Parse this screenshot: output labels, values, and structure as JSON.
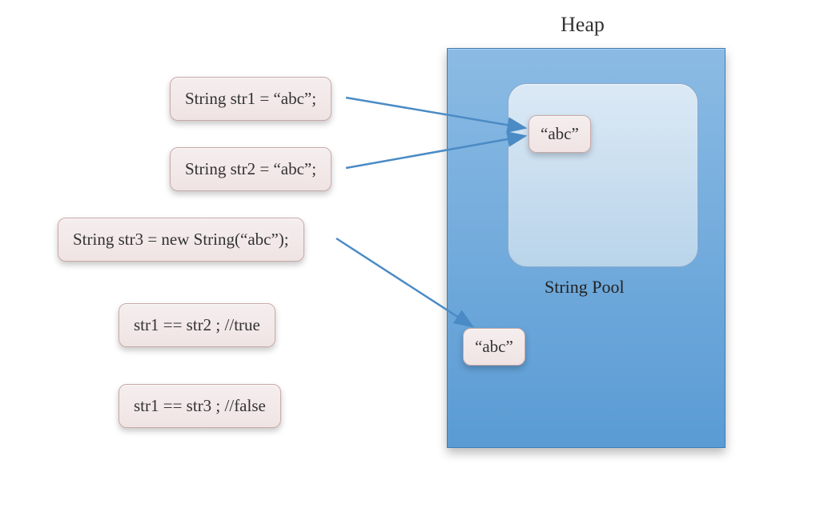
{
  "heap": {
    "label": "Heap",
    "pool_label": "String Pool",
    "pool_value": "“abc”",
    "heap_value": "“abc”"
  },
  "code": {
    "str1_decl": "String str1 = “abc”;",
    "str2_decl": "String str2 = “abc”;",
    "str3_decl": "String str3 = new String(“abc”);",
    "cmp12": "str1 == str2 ; //true",
    "cmp13": "str1 == str3 ; //false"
  },
  "diagram_meaning": {
    "description": "Java String pool diagram. str1 and str2 are String literals \"abc\" so they both reference the single interned \"abc\" object in the String Pool (inside the Heap). str3 uses new String(\"abc\"), which allocates a separate \"abc\" object directly in the Heap outside the pool. Therefore str1 == str2 is true (same reference) and str1 == str3 is false (different references).",
    "references": [
      {
        "var": "str1",
        "points_to": "string-pool-abc"
      },
      {
        "var": "str2",
        "points_to": "string-pool-abc"
      },
      {
        "var": "str3",
        "points_to": "heap-abc"
      }
    ],
    "comparisons": [
      {
        "expr": "str1 == str2",
        "result": true
      },
      {
        "expr": "str1 == str3",
        "result": false
      }
    ]
  }
}
